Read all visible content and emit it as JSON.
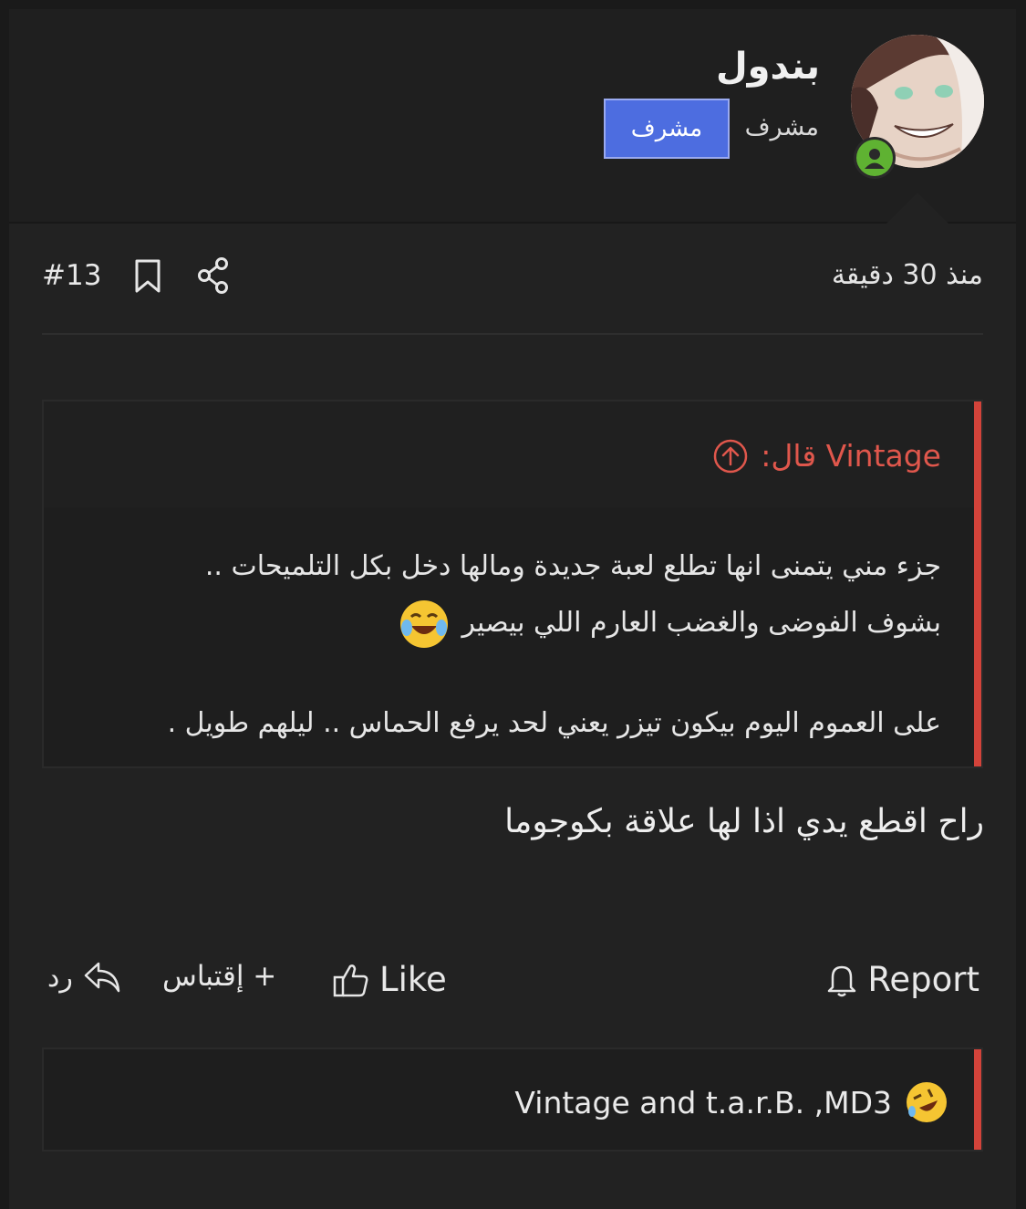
{
  "user": {
    "name": "بندول",
    "role": "مشرف",
    "banner": "مشرف",
    "status": "online"
  },
  "post": {
    "time": "منذ 30 دقيقة",
    "number": "#13"
  },
  "quote": {
    "author_line": "Vintage قال:",
    "line1": "جزء مني يتمنى انها تطلع لعبة جديدة ومالها دخل بكل التلميحات ..",
    "line2": "بشوف الفوضى والغضب العارم اللي بيصير",
    "line3": "على العموم اليوم بيكون تيزر يعني لحد يرفع الحماس .. ليلهم طويل ."
  },
  "message": "راح اقطع يدي اذا لها علاقة بكوجوما",
  "actions": {
    "report": "Report",
    "like": "Like",
    "quote": "+ إقتباس",
    "reply": "رد"
  },
  "reactions": {
    "text": "Vintage and t.a.r.B. ,MD3"
  },
  "colors": {
    "accent_red": "#d3433a",
    "banner_blue": "#4d6de0",
    "online_green": "#5fb232"
  }
}
